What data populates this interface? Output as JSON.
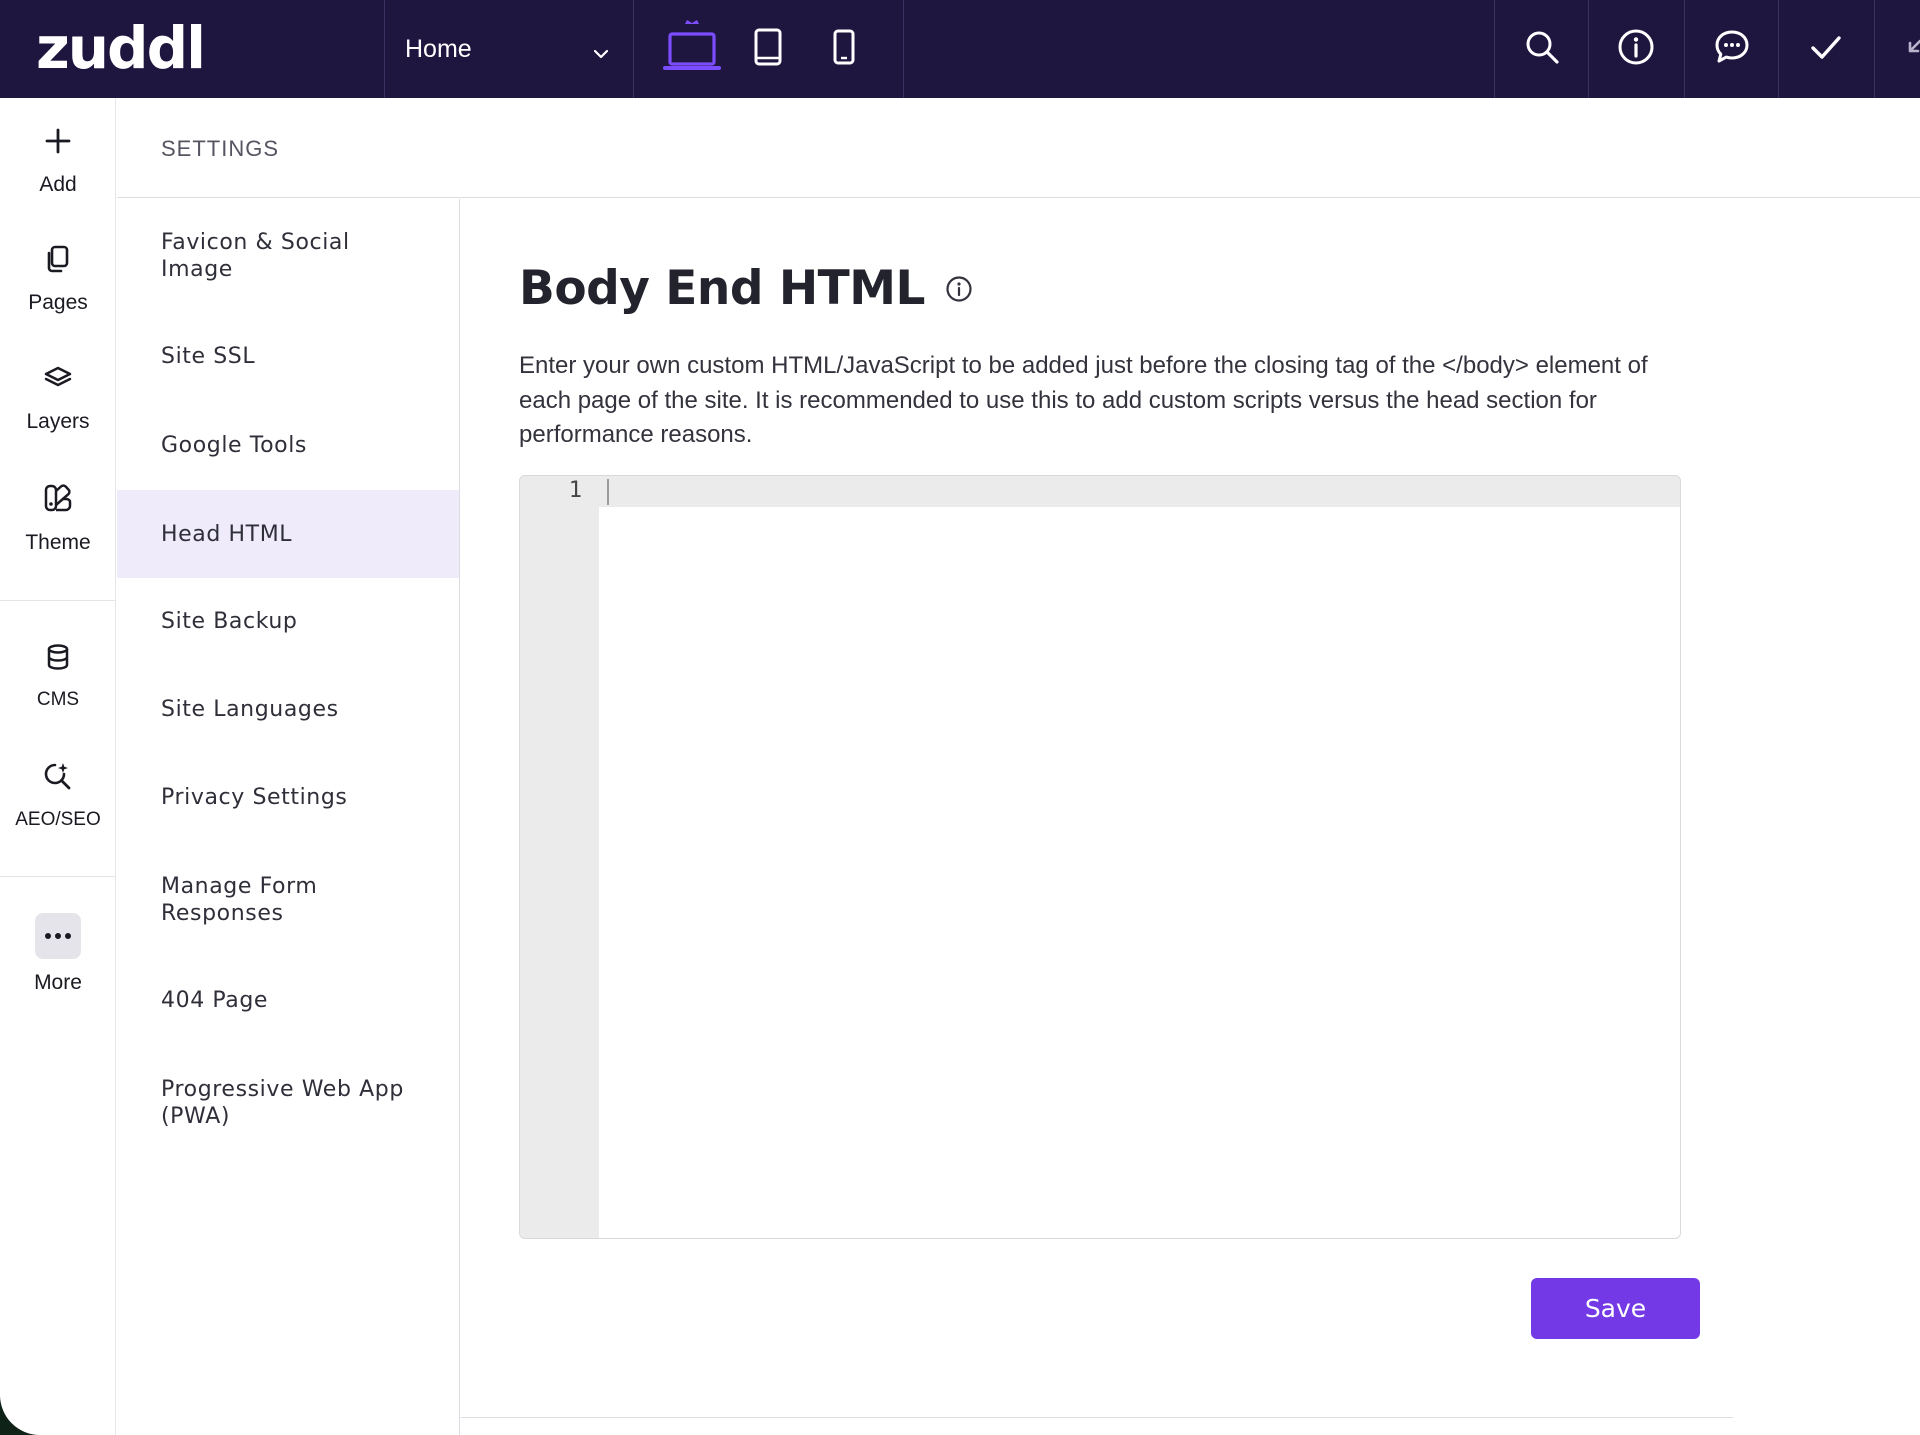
{
  "topbar": {
    "logo": "zuddl",
    "page_select": "Home",
    "colors": {
      "background": "#1f1640",
      "accent": "#7c4dff"
    },
    "devices": [
      "desktop-icon",
      "tablet-icon",
      "mobile-icon"
    ],
    "actions": [
      "search-icon",
      "info-icon",
      "comment-icon",
      "check-icon"
    ]
  },
  "rail": {
    "items": [
      {
        "label": "Add",
        "icon": "plus-icon"
      },
      {
        "label": "Pages",
        "icon": "pages-icon"
      },
      {
        "label": "Layers",
        "icon": "layers-icon"
      },
      {
        "label": "Theme",
        "icon": "theme-icon"
      },
      {
        "label": "CMS",
        "icon": "database-icon"
      },
      {
        "label": "AEO/SEO",
        "icon": "seo-search-icon"
      },
      {
        "label": "More",
        "icon": "ellipsis-icon"
      }
    ]
  },
  "settings": {
    "title": "SETTINGS",
    "nav": [
      "Favicon & Social Image",
      "Site SSL",
      "Google Tools",
      "Head HTML",
      "Site Backup",
      "Site Languages",
      "Privacy Settings",
      "Manage Form Responses",
      "404 Page",
      "Progressive Web App (PWA)"
    ],
    "active_item": "Head HTML"
  },
  "main": {
    "heading": "Body End HTML",
    "description": "Enter your own custom HTML/JavaScript to be added just before the closing tag of the </body> element of each page of the site. It is recommended to use this to add custom scripts versus the head section for performance reasons.",
    "editor": {
      "line_number": "1",
      "value": ""
    },
    "save_label": "Save",
    "colors": {
      "primary": "#7339e6",
      "active_nav": "#efebfb"
    }
  }
}
